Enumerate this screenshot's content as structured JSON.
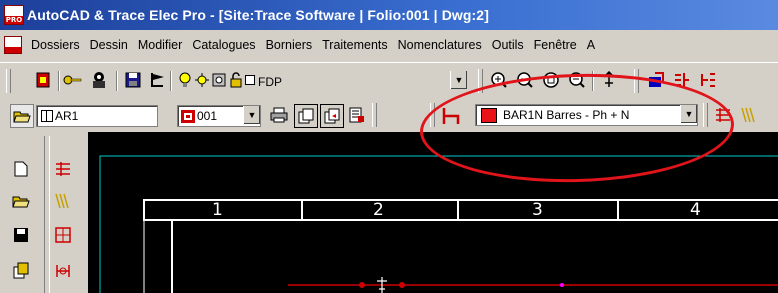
{
  "window": {
    "title": "AutoCAD & Trace Elec Pro - [Site:Trace Software | Folio:001 | Dwg:2]"
  },
  "menu": [
    "Dossiers",
    "Dessin",
    "Modifier",
    "Catalogues",
    "Borniers",
    "Traitements",
    "Nomenclatures",
    "Outils",
    "Fenêtre",
    "A"
  ],
  "toolbar1": {
    "layer_value": "FDP"
  },
  "toolbar2": {
    "ar_value": "AR1",
    "folio_value": "001",
    "bar_value": "BAR1N Barres - Ph + N",
    "bar_color": "#e8141a"
  },
  "drawing": {
    "columns": [
      "1",
      "2",
      "3",
      "4"
    ],
    "frame_color": "#00c8c8"
  },
  "annotation_color": "#e0141a"
}
